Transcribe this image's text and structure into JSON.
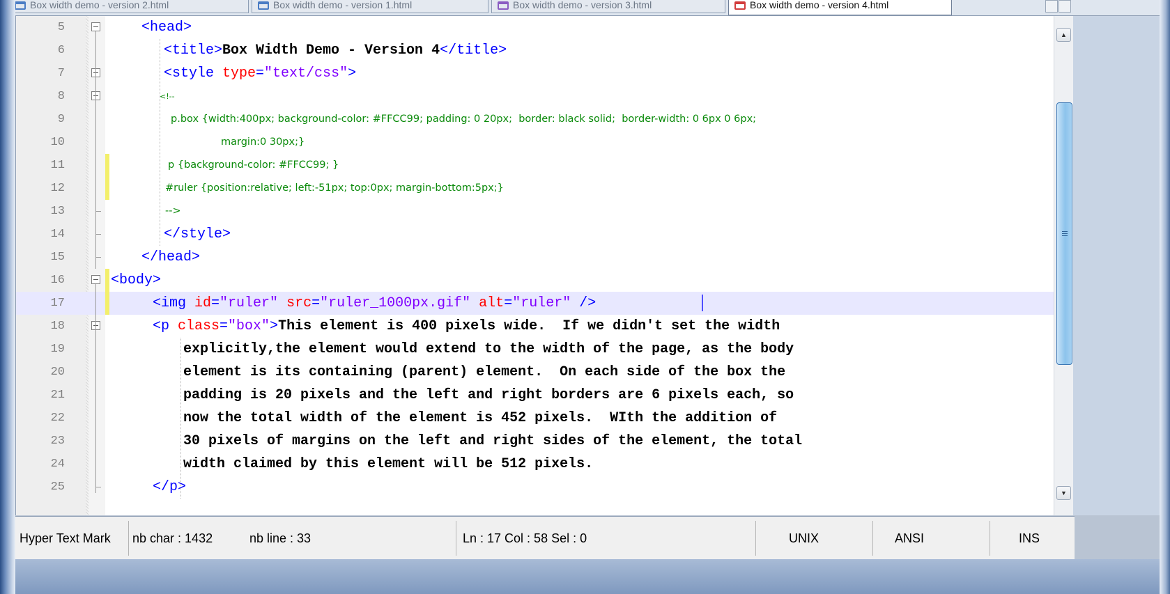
{
  "tabs": [
    {
      "label": "Box width demo - version 2.html",
      "active": false,
      "icon": "html-document-icon"
    },
    {
      "label": "Box width demo - version 1.html",
      "active": false,
      "icon": "html-document-icon"
    },
    {
      "label": "Box width demo - version 3.html",
      "active": false,
      "icon": "html-document-icon"
    },
    {
      "label": "Box width demo - version 4.html",
      "active": true,
      "icon": "html-document-unsaved-icon"
    }
  ],
  "editor": {
    "current_line": 17,
    "lines": [
      {
        "n": "5"
      },
      {
        "n": "6"
      },
      {
        "n": "7"
      },
      {
        "n": "8"
      },
      {
        "n": "9"
      },
      {
        "n": "10"
      },
      {
        "n": "11"
      },
      {
        "n": "12"
      },
      {
        "n": "13"
      },
      {
        "n": "14"
      },
      {
        "n": "15"
      },
      {
        "n": "16"
      },
      {
        "n": "17"
      },
      {
        "n": "18"
      },
      {
        "n": "19"
      },
      {
        "n": "20"
      },
      {
        "n": "21"
      },
      {
        "n": "22"
      },
      {
        "n": "23"
      },
      {
        "n": "24"
      },
      {
        "n": "25"
      }
    ],
    "code": {
      "l5": {
        "open": "<head>"
      },
      "l6": {
        "open": "<title>",
        "text": "Box Width Demo - Version 4",
        "close": "</title>"
      },
      "l7": {
        "open": "<style ",
        "attr": "type",
        "eq": "=",
        "val": "\"text/css\"",
        "end": ">"
      },
      "l8": {
        "text": "<!--"
      },
      "l9": {
        "text": "p.box {width:400px; background-color: #FFCC99; padding: 0 20px;  border: black solid;  border-width: 0 6px 0 6px;"
      },
      "l10": {
        "text": "margin:0 30px;}"
      },
      "l11": {
        "text": "p {background-color: #FFCC99; }"
      },
      "l12": {
        "text": "#ruler {position:relative; left:-51px; top:0px; margin-bottom:5px;}"
      },
      "l13": {
        "text": "-->"
      },
      "l14": {
        "close": "</style>"
      },
      "l15": {
        "close": "</head>"
      },
      "l16": {
        "open": "<body>"
      },
      "l17": {
        "open": "<img ",
        "a1": "id",
        "v1": "\"ruler\"",
        "a2": "src",
        "v2": "\"ruler_1000px.gif\"",
        "a3": "alt",
        "v3": "\"ruler\"",
        "end": " />",
        "eq": "="
      },
      "l18": {
        "open": "<p ",
        "attr": "class",
        "eq": "=",
        "val": "\"box\"",
        "end": ">",
        "text": "This element is 400 pixels wide.  If we didn't set the width"
      },
      "l19": {
        "text": "explicitly,the element would extend to the width of the page, as the body"
      },
      "l20": {
        "text": "element is its containing (parent) element.  On each side of the box the"
      },
      "l21": {
        "text": "padding is 20 pixels and the left and right borders are 6 pixels each, so"
      },
      "l22": {
        "text": "now the total width of the element is 452 pixels.  WIth the addition of"
      },
      "l23": {
        "text": "30 pixels of margins on the left and right sides of the element, the total"
      },
      "l24": {
        "text": "width claimed by this element will be 512 pixels."
      },
      "l25": {
        "close": "</p>"
      }
    }
  },
  "status": {
    "file_type": "Hyper Text Mark",
    "nb_char": "nb char : 1432",
    "nb_line": "nb line : 33",
    "position": "Ln : 17    Col : 58    Sel : 0",
    "eol": "UNIX",
    "encoding": "ANSI",
    "mode": "INS"
  },
  "colors": {
    "tag": "#0000ff",
    "attribute": "#ff0000",
    "attribute_value": "#8000ff",
    "css_comment": "#0a8a0a",
    "current_line": "#e8e8ff",
    "change_marker": "#f3ef6b"
  }
}
